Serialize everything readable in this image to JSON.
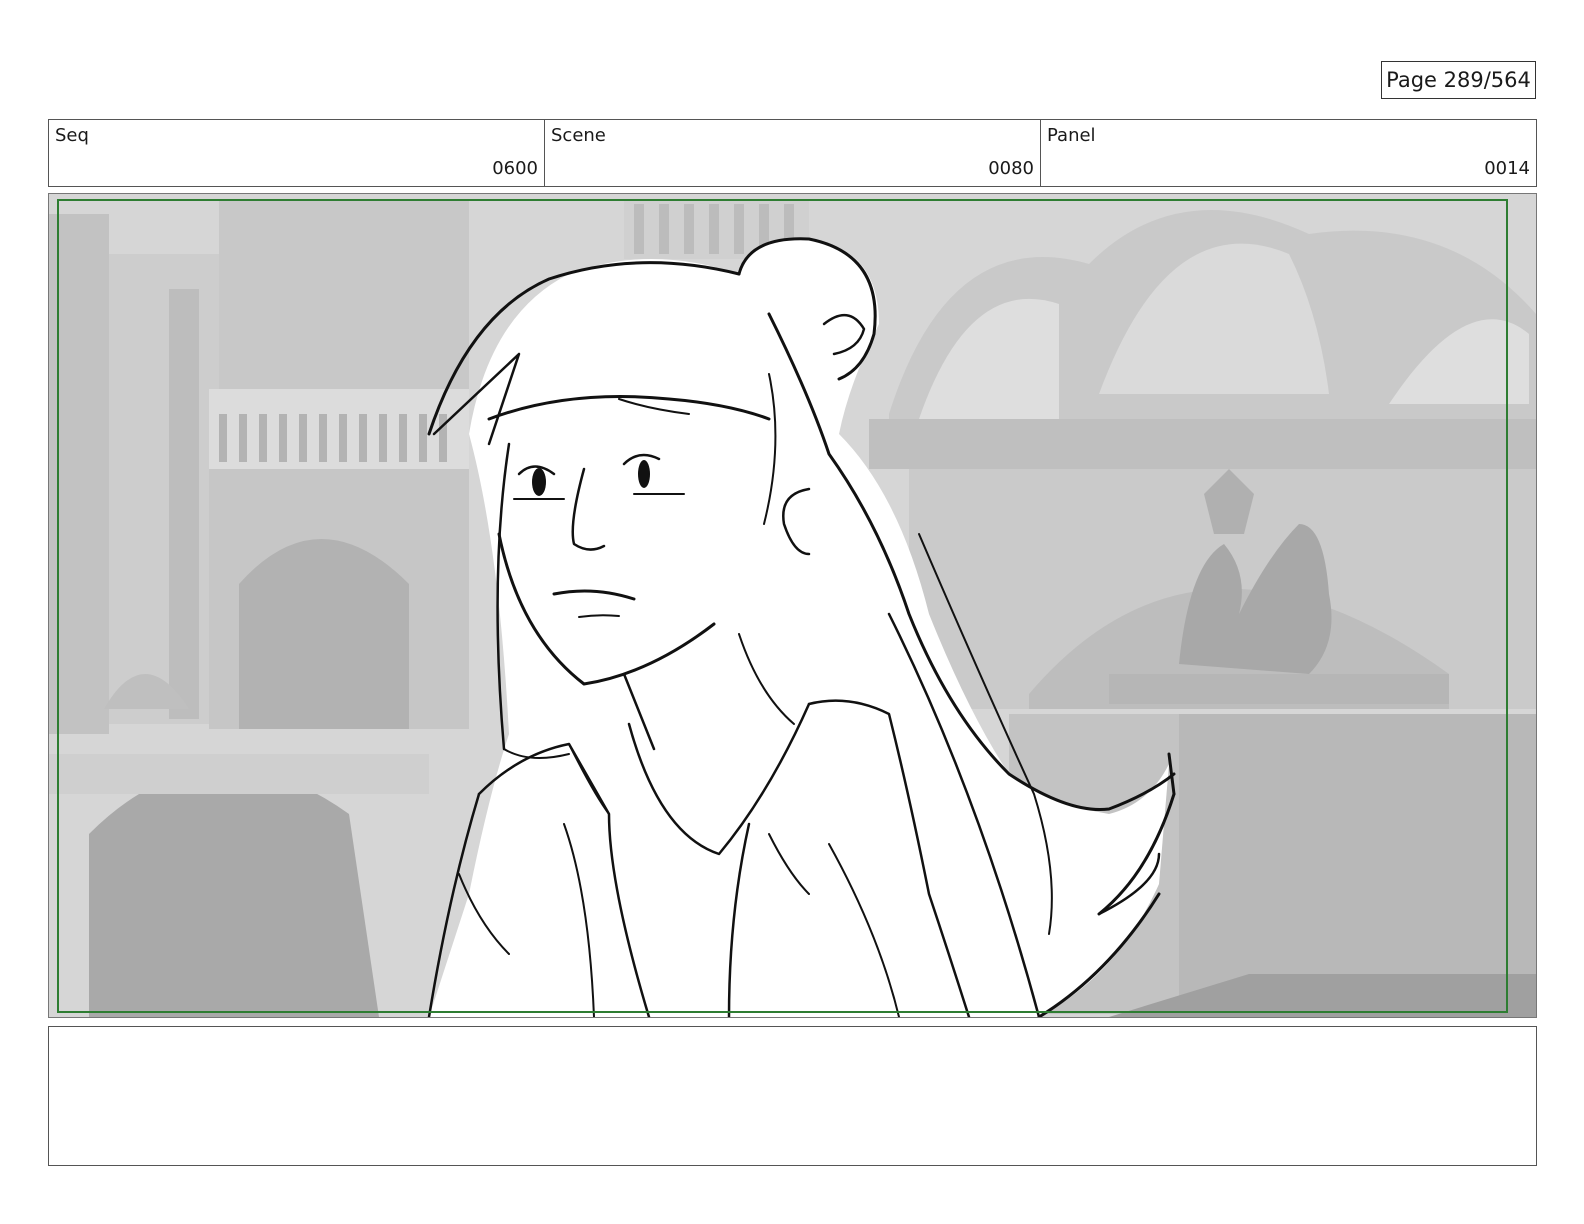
{
  "page": {
    "label": "Page 289/564"
  },
  "header": {
    "seq": {
      "label": "Seq",
      "value": "0600"
    },
    "scene": {
      "label": "Scene",
      "value": "0080"
    },
    "panel": {
      "label": "Panel",
      "value": "0014"
    }
  },
  "frame": {
    "safe_area_color": "#2e7d32",
    "background_tone": "#d4d4d4"
  },
  "notes": {
    "text": ""
  }
}
